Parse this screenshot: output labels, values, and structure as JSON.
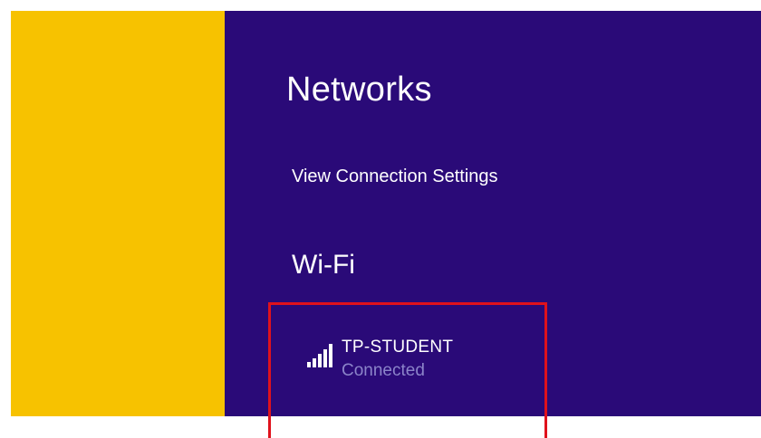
{
  "panel": {
    "title": "Networks",
    "view_settings_label": "View Connection Settings",
    "section_heading": "Wi-Fi"
  },
  "networks": [
    {
      "name": "TP-STUDENT",
      "status": "Connected",
      "signal_icon": "wifi-signal-icon",
      "signal_bars": 5,
      "signal_bars_active": 5,
      "highlighted": true
    }
  ],
  "colors": {
    "accent": "#f7c200",
    "panel_background": "#2a0a78",
    "text_primary": "#ffffff",
    "text_secondary": "#8b84c9",
    "highlight_border": "#e0121c"
  }
}
